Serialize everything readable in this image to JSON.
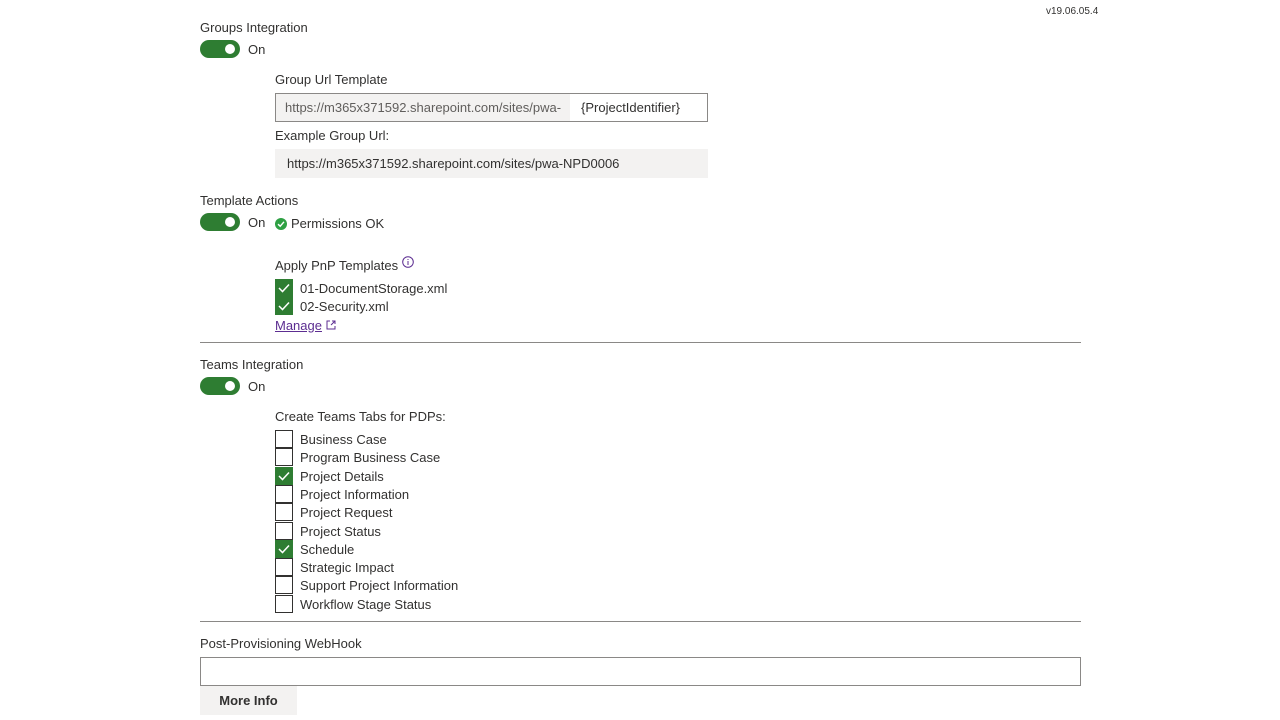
{
  "version": "v19.06.05.4",
  "groups": {
    "label": "Groups Integration",
    "toggle_text": "On",
    "url_template_label": "Group Url Template",
    "url_prefix": "https://m365x371592.sharepoint.com/sites/pwa-",
    "url_suffix": "{ProjectIdentifier}",
    "example_label": "Example Group Url:",
    "example_value": "https://m365x371592.sharepoint.com/sites/pwa-NPD0006"
  },
  "template_actions": {
    "label": "Template Actions",
    "toggle_text": "On",
    "permissions_text": "Permissions OK",
    "apply_label": "Apply PnP Templates",
    "templates": [
      {
        "label": "01-DocumentStorage.xml",
        "checked": true
      },
      {
        "label": "02-Security.xml",
        "checked": true
      }
    ],
    "manage_label": "Manage"
  },
  "teams": {
    "label": "Teams Integration",
    "toggle_text": "On",
    "tabs_label": "Create Teams Tabs for PDPs:",
    "pdps": [
      {
        "label": "Business Case",
        "checked": false
      },
      {
        "label": "Program Business Case",
        "checked": false
      },
      {
        "label": "Project Details",
        "checked": true
      },
      {
        "label": "Project Information",
        "checked": false
      },
      {
        "label": "Project Request",
        "checked": false
      },
      {
        "label": "Project Status",
        "checked": false
      },
      {
        "label": "Schedule",
        "checked": true
      },
      {
        "label": "Strategic Impact",
        "checked": false
      },
      {
        "label": "Support Project Information",
        "checked": false
      },
      {
        "label": "Workflow Stage Status",
        "checked": false
      }
    ]
  },
  "webhook": {
    "label": "Post-Provisioning WebHook",
    "value": "",
    "more_info_label": "More Info"
  },
  "colors": {
    "toggle_on": "#2e7d32",
    "link": "#5c2d91",
    "ok_green": "#2ea043"
  }
}
